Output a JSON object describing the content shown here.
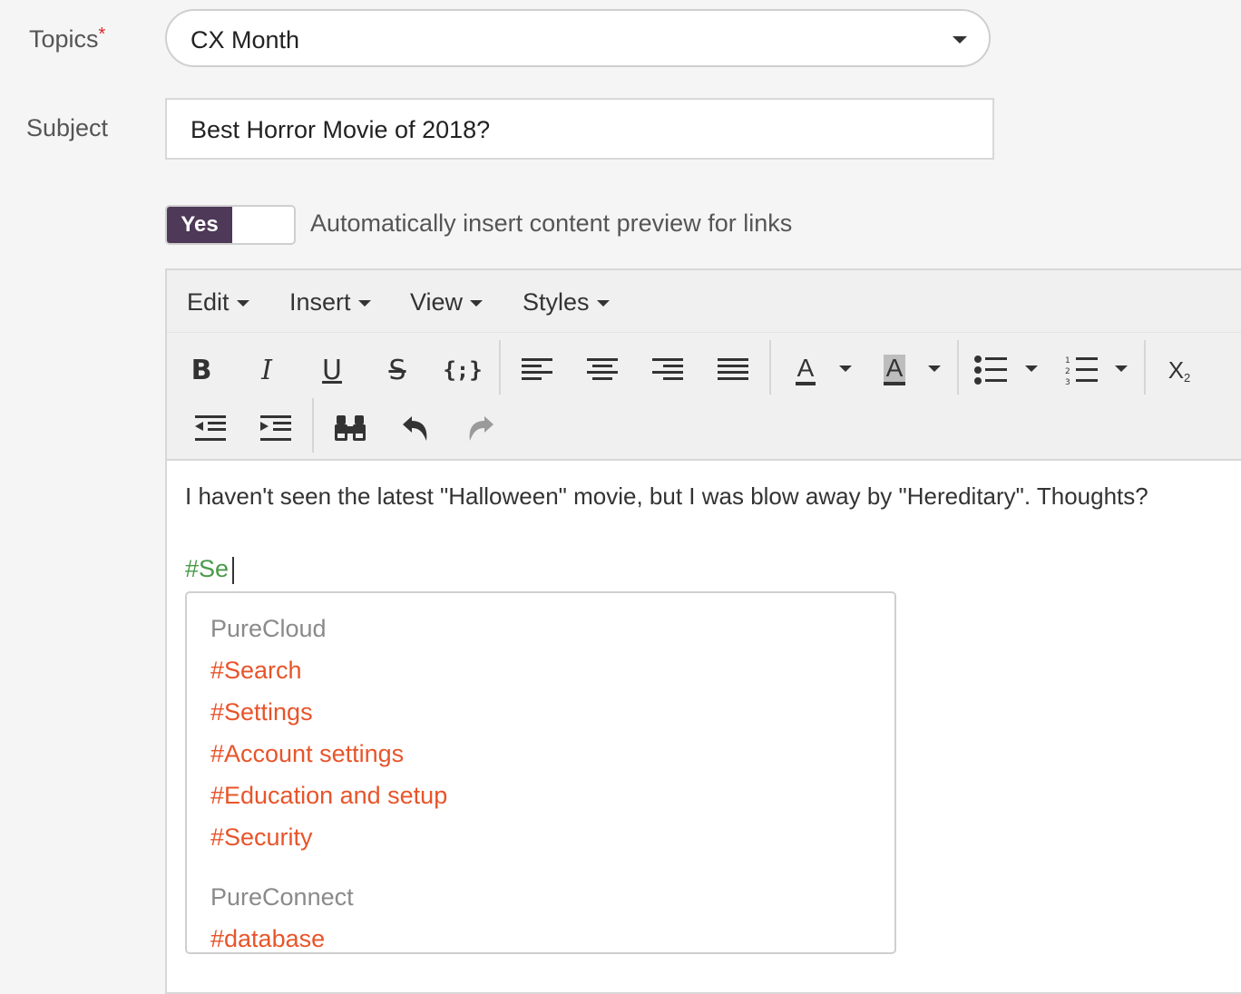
{
  "form": {
    "topics_label": "Topics",
    "required_mark": "*",
    "topics_value": "CX Month",
    "subject_label": "Subject",
    "subject_value": "Best Horror Movie of 2018?",
    "toggle_label": "Yes",
    "toggle_text": "Automatically insert content preview for links"
  },
  "editor": {
    "menu": [
      "Edit",
      "Insert",
      "View",
      "Styles"
    ],
    "toolbar_icons": [
      "bold-icon",
      "italic-icon",
      "underline-icon",
      "strikethrough-icon",
      "code-icon",
      "align-left-icon",
      "align-center-icon",
      "align-right-icon",
      "align-justify-icon",
      "text-color-icon",
      "background-color-icon",
      "bullet-list-icon",
      "numbered-list-icon",
      "subscript-icon",
      "outdent-icon",
      "indent-icon",
      "find-icon",
      "undo-icon",
      "redo-icon"
    ],
    "content": "I haven't seen the latest \"Halloween\" movie, but I was blow away by \"Hereditary\". Thoughts?",
    "typed_hashtag": "#Se"
  },
  "suggestions": {
    "groups": [
      {
        "name": "PureCloud",
        "items": [
          "#Search",
          "#Settings",
          "#Account settings",
          "#Education and setup",
          "#Security"
        ]
      },
      {
        "name": "PureConnect",
        "items": [
          "#database"
        ]
      }
    ]
  },
  "colors": {
    "toggle_on": "#4e3958",
    "hashtag_suggestion": "#e8542a",
    "typed_hashtag": "#4a9a4a",
    "required": "#d9262c"
  }
}
